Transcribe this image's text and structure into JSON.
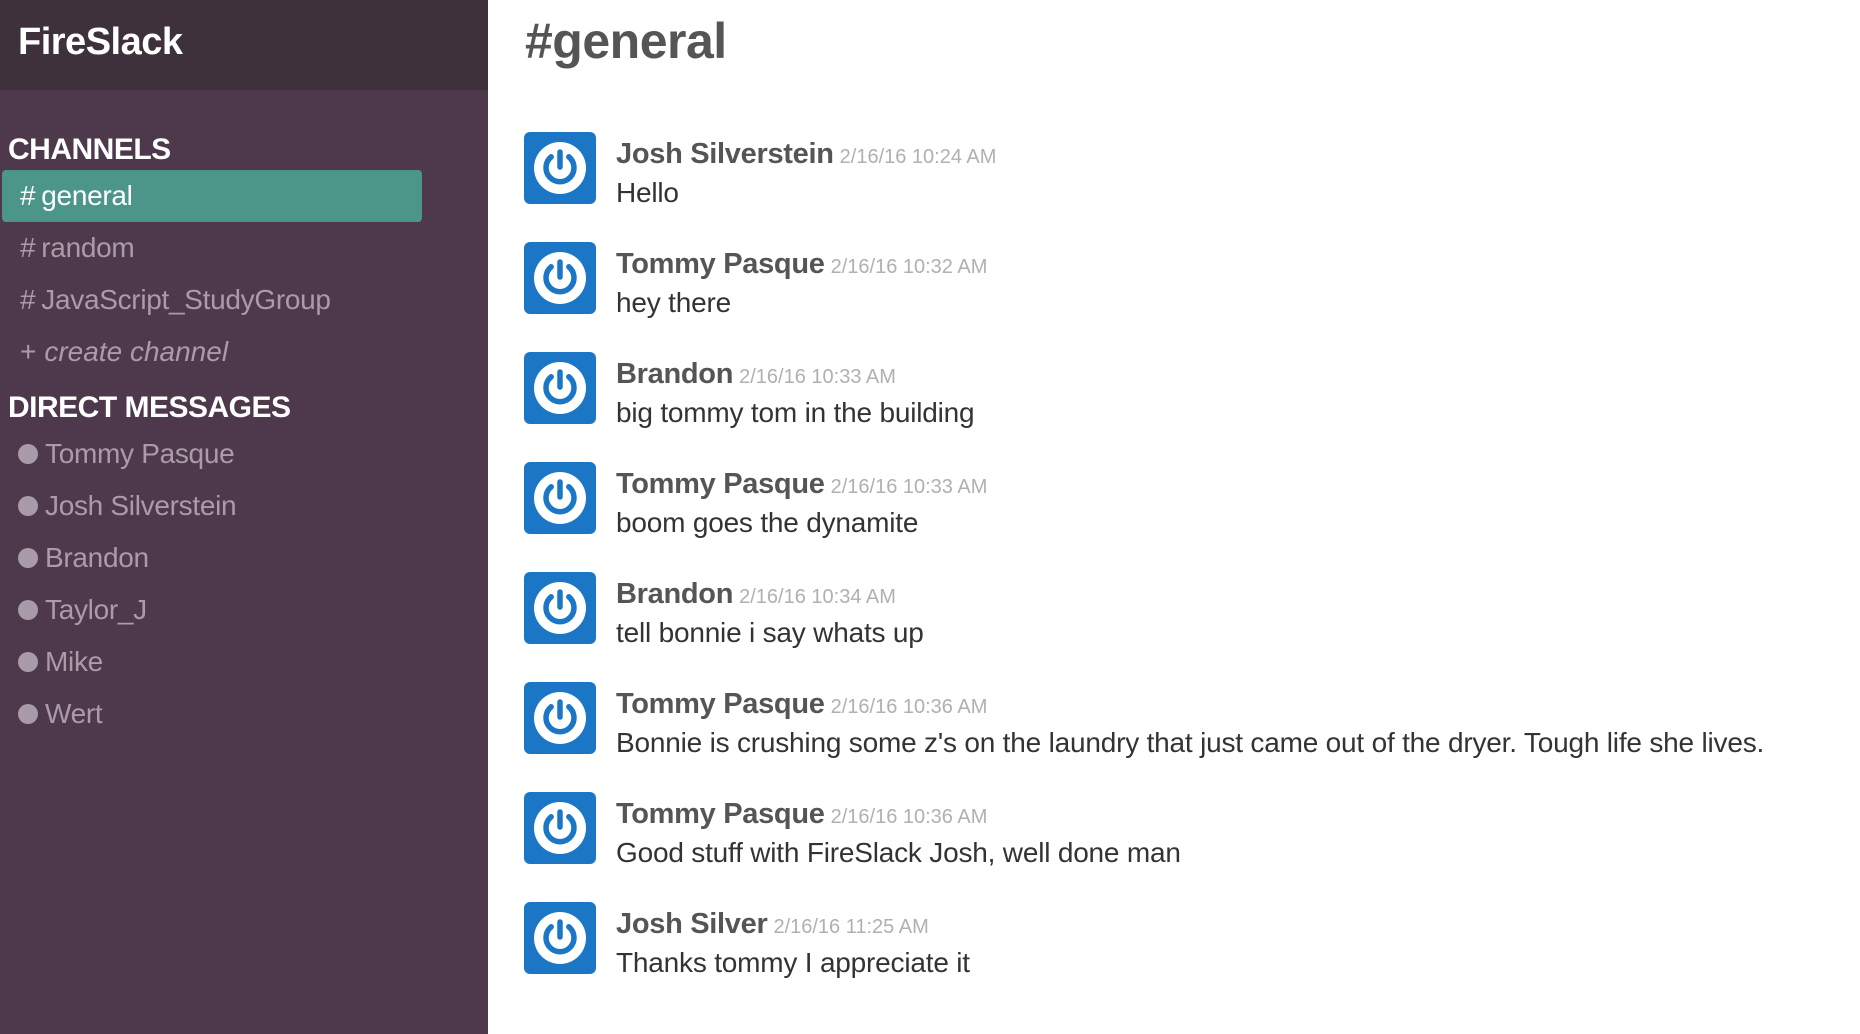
{
  "app": {
    "title": "FireSlack"
  },
  "colors": {
    "sidebar_bg": "#4d394b",
    "sidebar_header_bg": "#3e313c",
    "active_channel_bg": "#4c9689",
    "avatar_bg": "#1b77c6"
  },
  "sidebar": {
    "channels_title": "CHANNELS",
    "channels": [
      {
        "label": "general",
        "active": true
      },
      {
        "label": "random",
        "active": false
      },
      {
        "label": "JavaScript_StudyGroup",
        "active": false
      }
    ],
    "create_channel": {
      "plus": "+",
      "label": "create channel"
    },
    "dm_title": "DIRECT MESSAGES",
    "direct_messages": [
      {
        "name": "Tommy Pasque"
      },
      {
        "name": "Josh Silverstein"
      },
      {
        "name": "Brandon"
      },
      {
        "name": "Taylor_J"
      },
      {
        "name": "Mike"
      },
      {
        "name": "Wert"
      }
    ]
  },
  "main": {
    "channel_title": "#general",
    "messages": [
      {
        "author": "Josh Silverstein",
        "timestamp": "2/16/16 10:24 AM",
        "text": "Hello",
        "avatar_icon": "power-icon"
      },
      {
        "author": "Tommy Pasque",
        "timestamp": "2/16/16 10:32 AM",
        "text": "hey there",
        "avatar_icon": "power-icon"
      },
      {
        "author": "Brandon",
        "timestamp": "2/16/16 10:33 AM",
        "text": "big tommy tom in the building",
        "avatar_icon": "power-icon"
      },
      {
        "author": "Tommy Pasque",
        "timestamp": "2/16/16 10:33 AM",
        "text": "boom goes the dynamite",
        "avatar_icon": "power-icon"
      },
      {
        "author": "Brandon",
        "timestamp": "2/16/16 10:34 AM",
        "text": "tell bonnie i say whats up",
        "avatar_icon": "power-icon"
      },
      {
        "author": "Tommy Pasque",
        "timestamp": "2/16/16 10:36 AM",
        "text": "Bonnie is crushing some z's on the laundry that just came out of the dryer. Tough life she lives.",
        "avatar_icon": "power-icon"
      },
      {
        "author": "Tommy Pasque",
        "timestamp": "2/16/16 10:36 AM",
        "text": "Good stuff with FireSlack Josh, well done man",
        "avatar_icon": "power-icon"
      },
      {
        "author": "Josh Silver",
        "timestamp": "2/16/16 11:25 AM",
        "text": "Thanks tommy I appreciate it",
        "avatar_icon": "power-icon"
      }
    ]
  }
}
